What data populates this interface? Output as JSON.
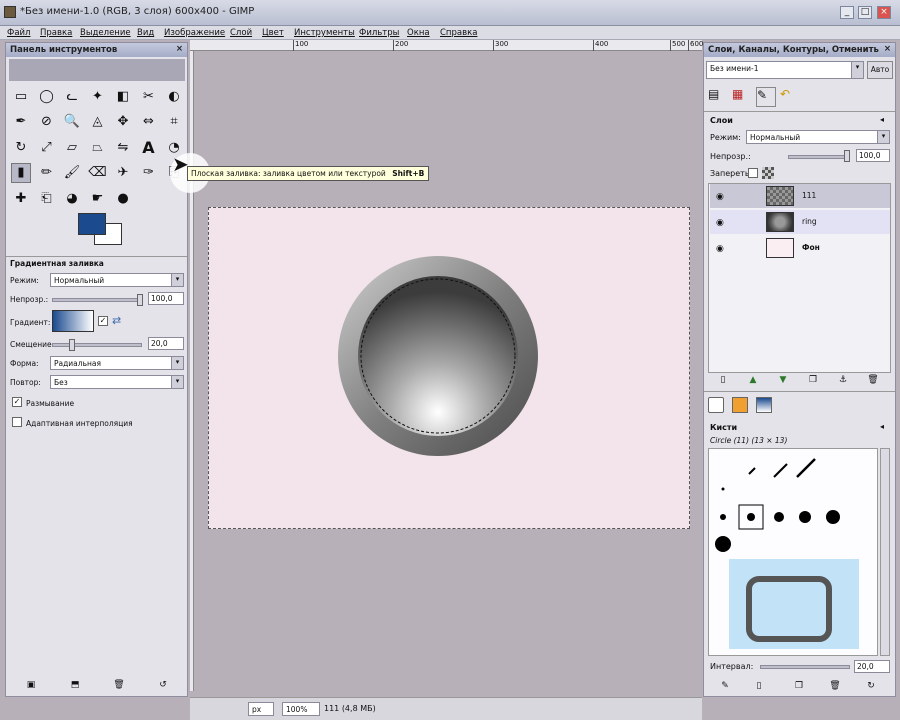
{
  "window": {
    "title": "*Без имени-1.0 (RGB, 3 слоя) 600x400 - GIMP"
  },
  "menu": [
    "Файл",
    "Правка",
    "Выделение",
    "Вид",
    "Изображение",
    "Слой",
    "Цвет",
    "Инструменты",
    "Фильтры",
    "Окна",
    "Справка"
  ],
  "ruler_ticks": [
    "100",
    "200",
    "300",
    "400",
    "500",
    "600"
  ],
  "toolbox": {
    "title": "Панель инструментов",
    "tools": [
      "rect-select",
      "ellipse-select",
      "free-select",
      "fuzzy-select",
      "by-color-select",
      "scissors-select",
      "foreground-select",
      "paths",
      "color-picker",
      "zoom",
      "measure",
      "move",
      "align",
      "crop",
      "rotate",
      "scale",
      "shear",
      "perspective",
      "flip",
      "text",
      "bucket-fill",
      "blend",
      "pencil",
      "paintbrush",
      "eraser",
      "airbrush",
      "ink",
      "clone",
      "heal",
      "perspective-clone",
      "blur",
      "smudge",
      "dodge-burn"
    ],
    "tool_options_title": "Градиентная заливка",
    "mode_label": "Режим:",
    "mode_value": "Нормальный",
    "opacity_label": "Непрозр.:",
    "opacity_value": "100,0",
    "gradient_label": "Градиент:",
    "offset_label": "Смещение:",
    "offset_value": "20,0",
    "shape_label": "Форма:",
    "shape_value": "Радиальная",
    "repeat_label": "Повтор:",
    "repeat_value": "Без",
    "dither_label": "Размывание",
    "adaptive_label": "Адаптивная интерполяция"
  },
  "tooltip": {
    "text": "Плоская заливка: заливка цветом или текстурой",
    "shortcut": "Shift+B"
  },
  "dock": {
    "title": "Слои, Каналы, Контуры, Отменить",
    "image_select": "Без имени-1",
    "auto_button": "Авто",
    "layers_title": "Слои",
    "mode_label": "Режим:",
    "mode_value": "Нормальный",
    "opacity_label": "Непрозр.:",
    "opacity_value": "100,0",
    "lock_label": "Запереть:",
    "layers": [
      {
        "name": "111"
      },
      {
        "name": "ring"
      },
      {
        "name": "Фон"
      }
    ],
    "brushes_title": "Кисти",
    "brush_name": "Circle (11) (13 × 13)",
    "spacing_label": "Интервал:",
    "spacing_value": "20,0"
  },
  "status": {
    "unit": "px",
    "zoom": "100%",
    "info": "111 (4,8 МБ)"
  }
}
